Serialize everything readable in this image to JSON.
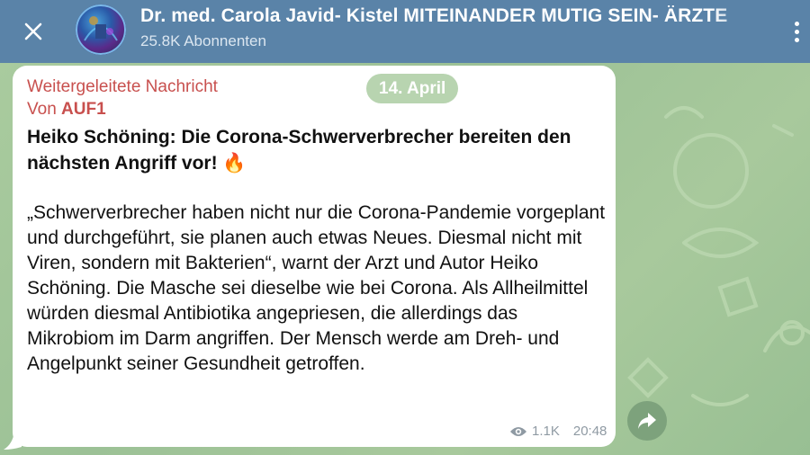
{
  "header": {
    "close_icon": "close-icon",
    "channel_title": "Dr. med. Carola Javid- Kistel MITEINANDER MUTIG SEIN- ÄRZTE",
    "subscribers": "25.8K Abonnenten",
    "menu_icon": "more-vertical-icon"
  },
  "message": {
    "forwarded_label": "Weitergeleitete Nachricht",
    "from_prefix": "Von",
    "from_source": "AUF1",
    "date": "14. April",
    "title": "Heiko Schöning: Die Corona-Schwerverbrecher bereiten den nächsten Angriff vor! 🔥",
    "body": "„Schwerverbrecher haben nicht nur die Corona-Pandemie vorgeplant und durchgeführt, sie planen auch etwas Neues. Diesmal nicht mit Viren, sondern mit Bakterien“, warnt der Arzt und Autor Heiko Schöning. Die Masche sei dieselbe wie bei Corona. Als Allheilmittel würden diesmal Antibiotika angepriesen, die allerdings das Mikrobiom im Darm angriffen. Der Mensch werde am Dreh- und Angelpunkt seiner Gesundheit getroffen.",
    "views": "1.1K",
    "time": "20:48"
  },
  "actions": {
    "share_icon": "share-arrow-icon"
  },
  "colors": {
    "header_bg": "#5a83a8",
    "accent_red": "#c8504e",
    "chat_bg": "#a9cb9e",
    "share_bg": "#7da27c"
  }
}
